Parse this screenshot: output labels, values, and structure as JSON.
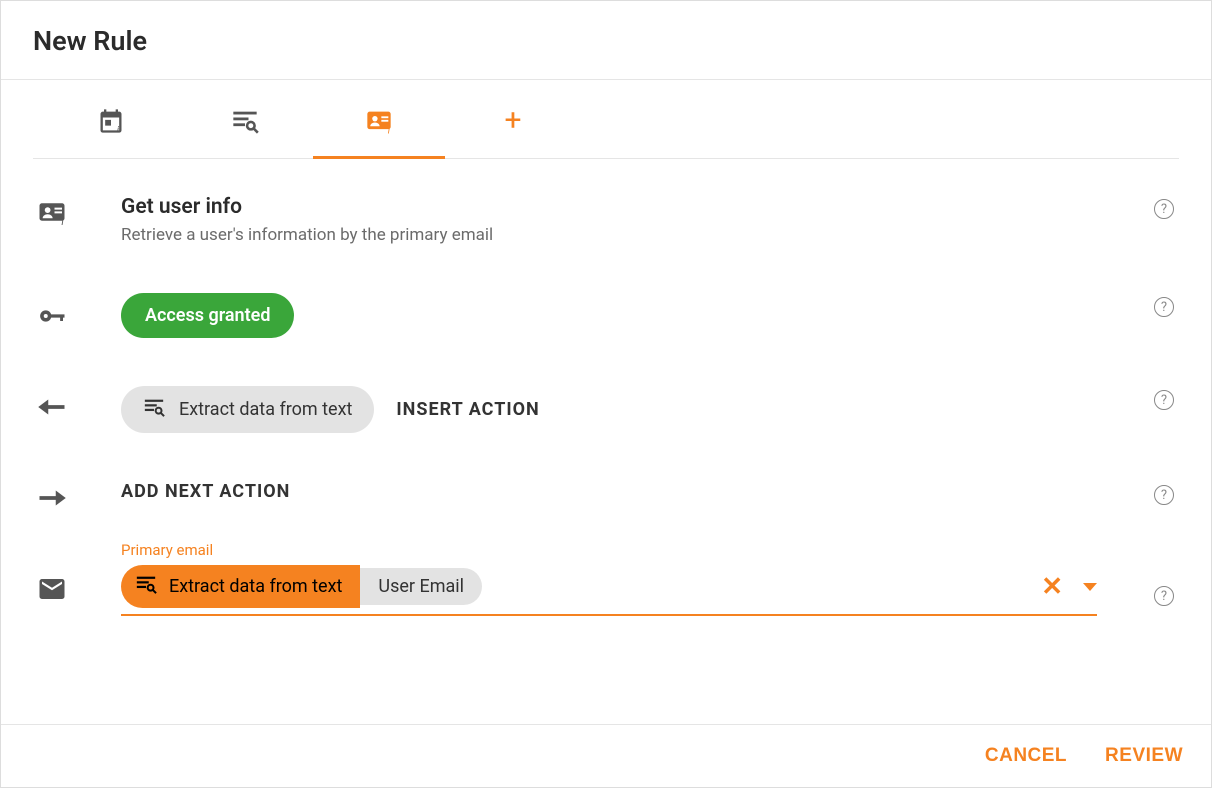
{
  "header": {
    "title": "New Rule"
  },
  "tabs": {
    "items": [
      {
        "name": "calendar-info-icon"
      },
      {
        "name": "extract-text-icon"
      },
      {
        "name": "user-info-icon"
      },
      {
        "name": "add-icon"
      }
    ],
    "active_index": 2
  },
  "steps": {
    "info": {
      "title": "Get user info",
      "desc": "Retrieve a user's information by the primary email"
    },
    "access": {
      "chip": "Access granted"
    },
    "insert": {
      "chip_label": "Extract data from text",
      "action_label": "INSERT ACTION"
    },
    "next": {
      "label": "ADD NEXT ACTION"
    },
    "primary_email": {
      "field_label": "Primary email",
      "chip_orange": "Extract data from text",
      "chip_gray": "User Email"
    }
  },
  "footer": {
    "cancel": "CANCEL",
    "review": "REVIEW"
  }
}
